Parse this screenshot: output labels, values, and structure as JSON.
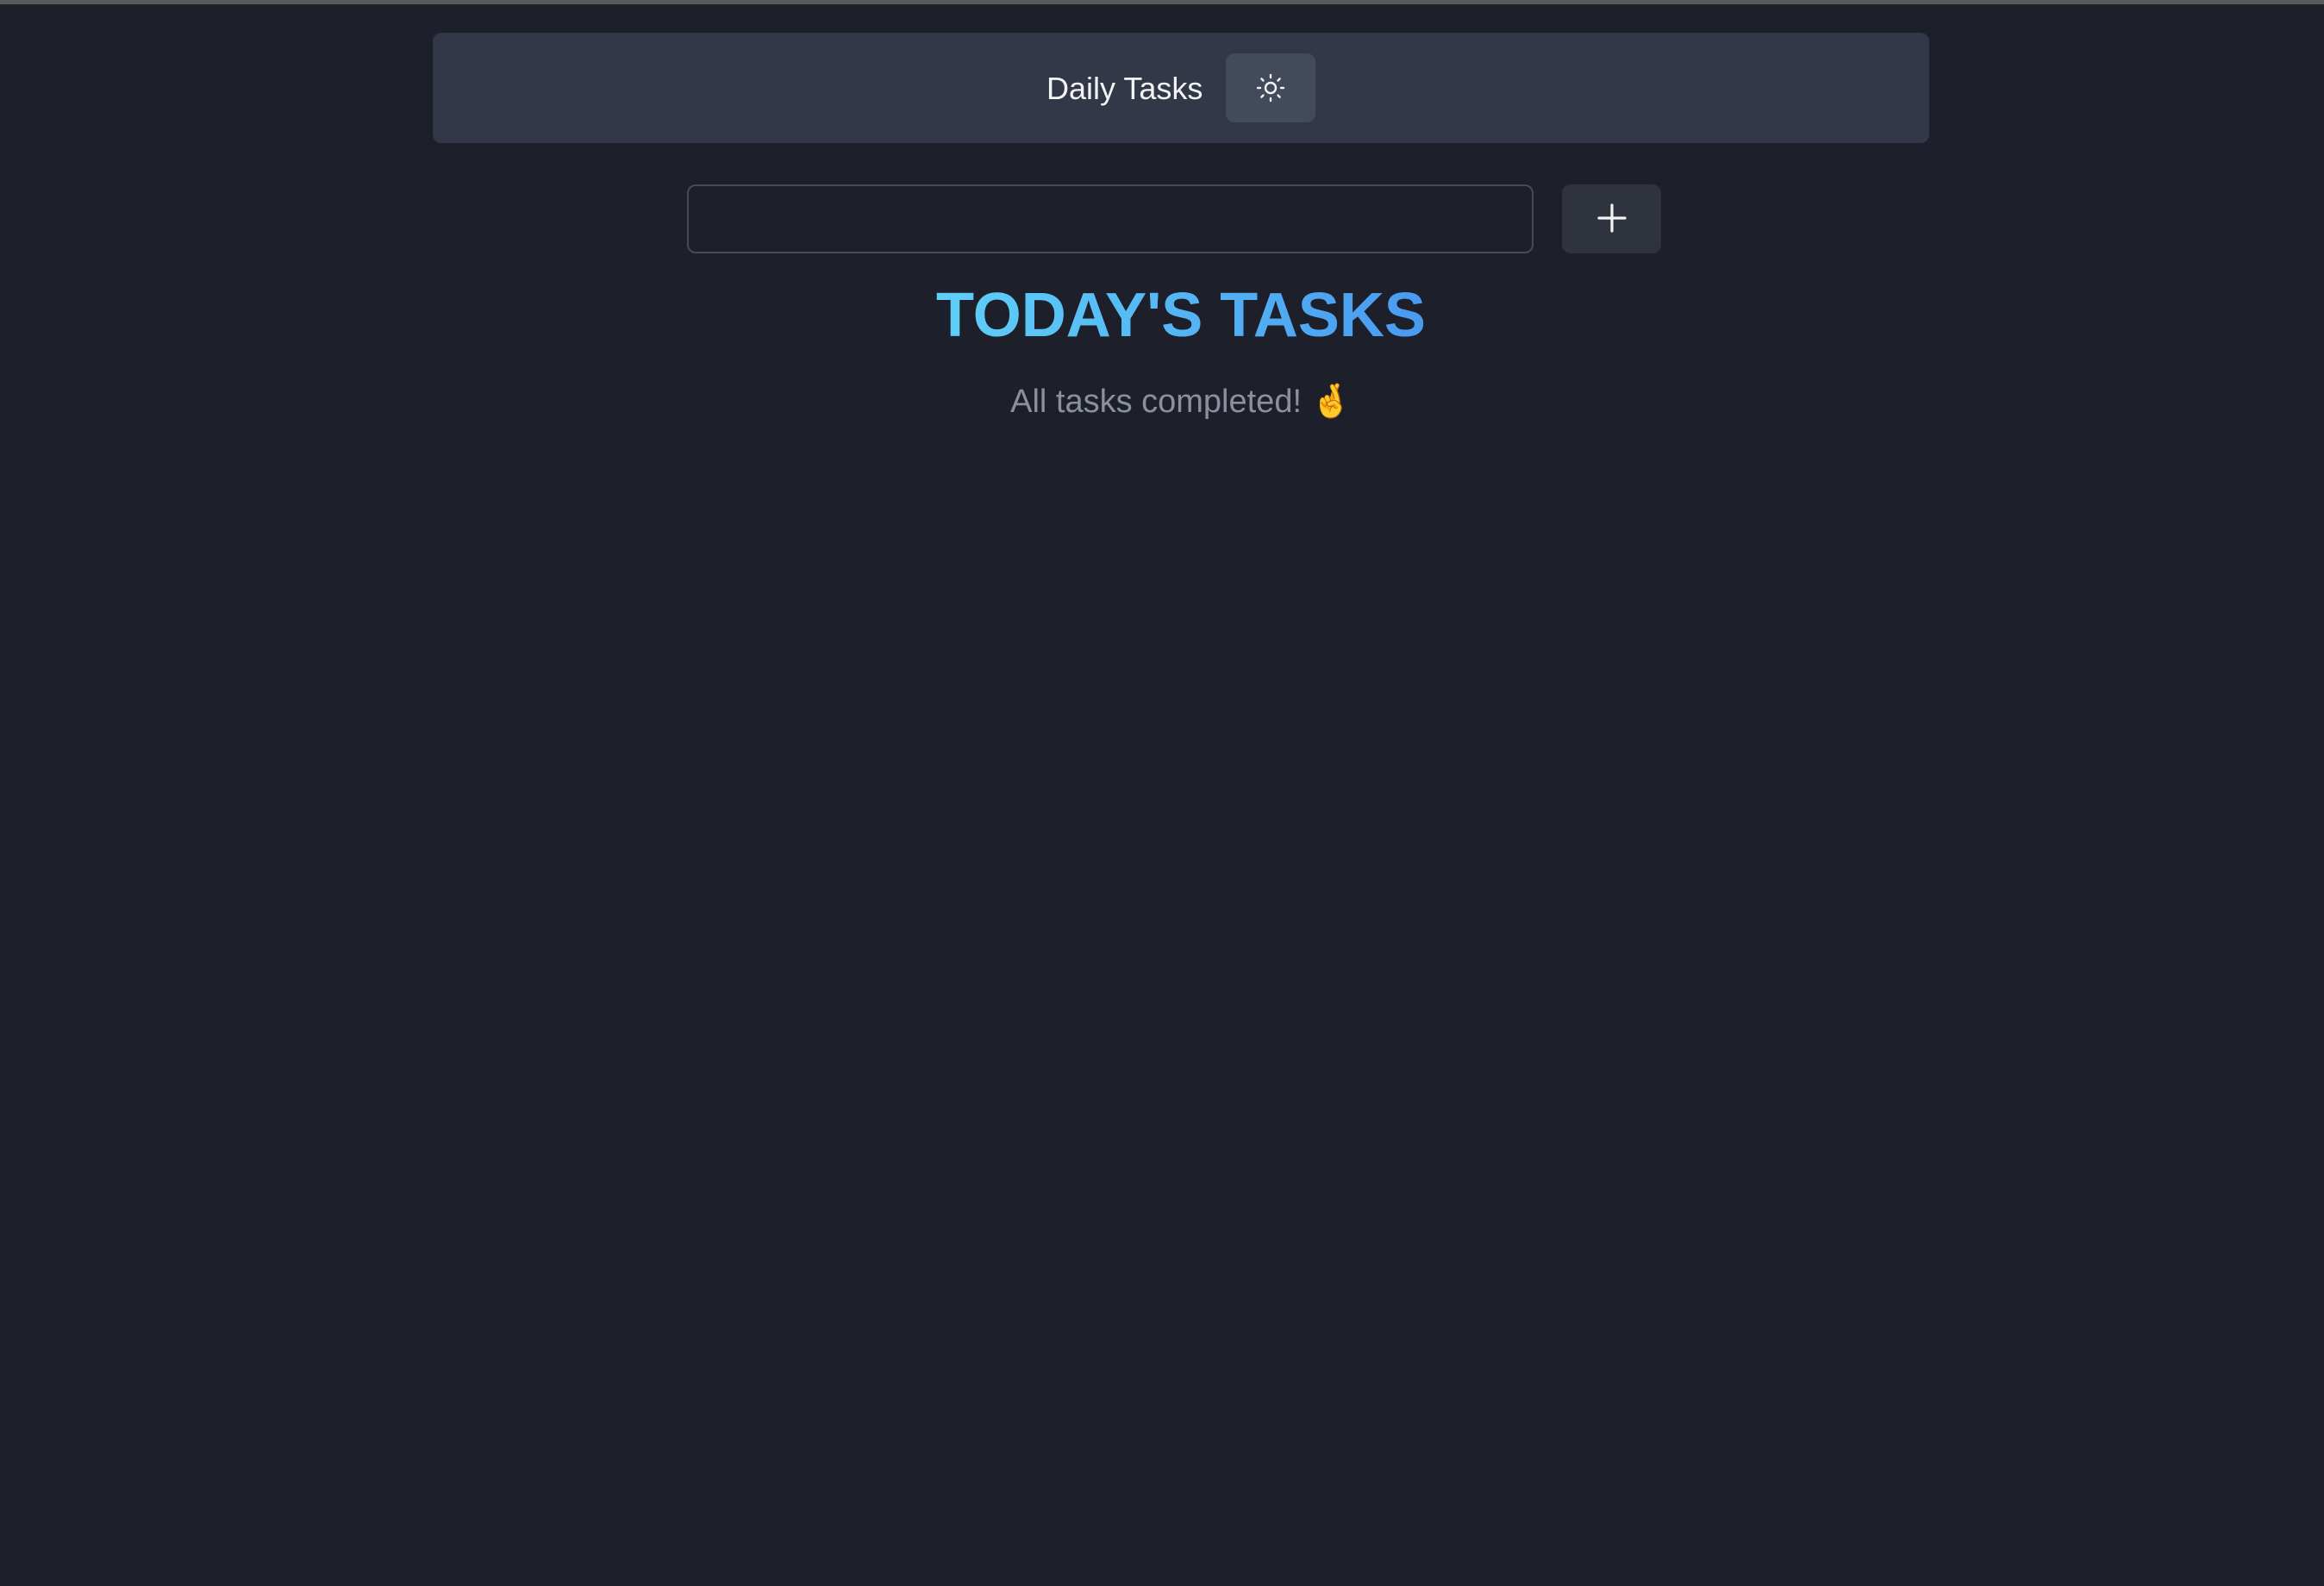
{
  "header": {
    "title": "Daily Tasks",
    "theme_toggle_icon": "sun-icon"
  },
  "task_entry": {
    "value": "",
    "placeholder": "",
    "add_button_icon": "plus-icon"
  },
  "tasks_section": {
    "heading": "TODAY'S TASKS",
    "empty_message": "All tasks completed! 🤞"
  },
  "colors": {
    "background": "#1d202b",
    "header_background": "#323847",
    "heading_gradient_start": "#5fd0f7",
    "heading_gradient_end": "#4a9af0",
    "muted_text": "#8a909c"
  }
}
